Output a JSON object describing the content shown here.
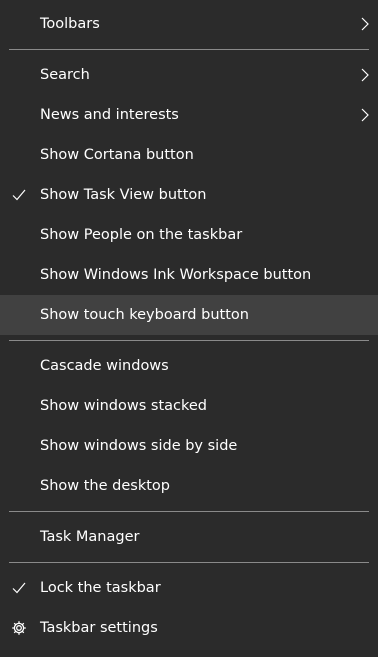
{
  "menu": {
    "groups": [
      [
        {
          "label": "Toolbars",
          "submenu": true
        }
      ],
      [
        {
          "label": "Search",
          "submenu": true
        },
        {
          "label": "News and interests",
          "submenu": true
        },
        {
          "label": "Show Cortana button"
        },
        {
          "label": "Show Task View button",
          "checked": true
        },
        {
          "label": "Show People on the taskbar"
        },
        {
          "label": "Show Windows Ink Workspace button"
        },
        {
          "label": "Show touch keyboard button",
          "highlighted": true
        }
      ],
      [
        {
          "label": "Cascade windows"
        },
        {
          "label": "Show windows stacked"
        },
        {
          "label": "Show windows side by side"
        },
        {
          "label": "Show the desktop"
        }
      ],
      [
        {
          "label": "Task Manager"
        }
      ],
      [
        {
          "label": "Lock the taskbar",
          "checked": true
        },
        {
          "label": "Taskbar settings",
          "icon": "gear-icon"
        }
      ]
    ]
  },
  "colors": {
    "background": "#2b2b2b",
    "highlight": "#414141",
    "separator": "#8a8a8a",
    "text": "#ffffff"
  }
}
